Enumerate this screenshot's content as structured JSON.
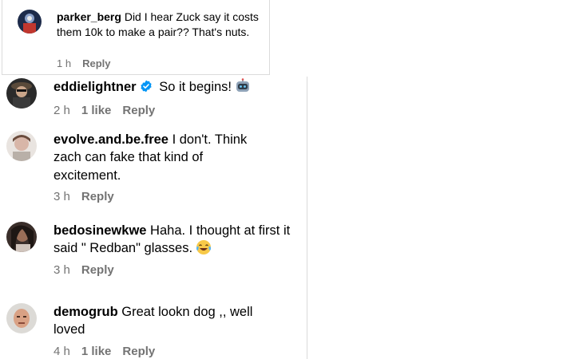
{
  "comments_top": {
    "username": "parker_berg",
    "text": "Did I hear Zuck say it costs them 10k to make a pair?? That's nuts.",
    "time": "1 h",
    "reply_label": "Reply"
  },
  "comments": [
    {
      "username": "eddielightner",
      "verified": true,
      "text": "So it begins!",
      "emoji": "robot-emoji",
      "time": "2 h",
      "likes": "1 like",
      "reply_label": "Reply"
    },
    {
      "username": "evolve.and.be.free",
      "verified": false,
      "text": "I don't. Think zach can fake that kind of excitement.",
      "time": "3 h",
      "reply_label": "Reply"
    },
    {
      "username": "bedosinewkwe",
      "verified": false,
      "text": "Haha. I thought at first it said \" Redban\" glasses.",
      "emoji": "tears-of-joy-emoji",
      "time": "3 h",
      "reply_label": "Reply"
    },
    {
      "username": "demogrub",
      "verified": false,
      "text": "Great lookn dog ,, well loved",
      "time": "4 h",
      "likes": "1 like",
      "reply_label": "Reply"
    }
  ],
  "colors": {
    "meta_text": "#737373",
    "verified_badge": "#0095f6",
    "divider": "#dbdbdb"
  }
}
